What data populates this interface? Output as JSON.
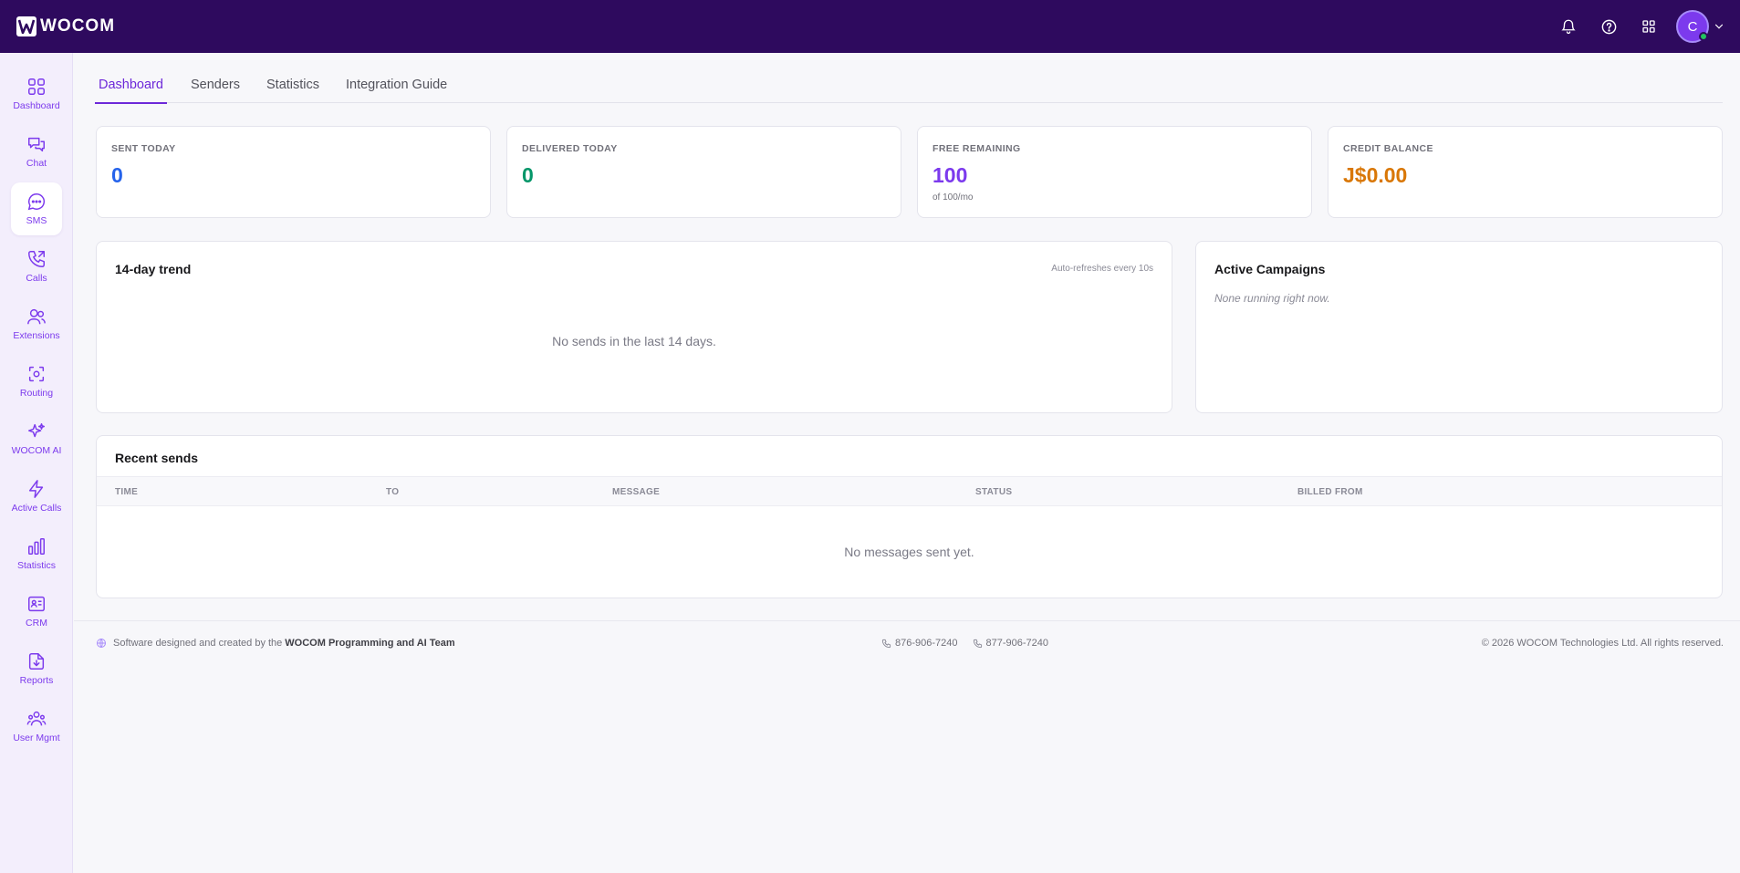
{
  "brand": {
    "name": "WOCOM"
  },
  "topbar": {
    "icons": [
      "bell-icon",
      "help-icon",
      "apps-grid-icon"
    ],
    "avatar_initial": "C"
  },
  "sidebar": {
    "active": "SMS",
    "items": [
      {
        "label": "Dashboard",
        "icon": "grid-icon"
      },
      {
        "label": "Chat",
        "icon": "chat-bubbles-icon"
      },
      {
        "label": "SMS",
        "icon": "message-dots-icon"
      },
      {
        "label": "Calls",
        "icon": "phone-outgoing-icon"
      },
      {
        "label": "Extensions",
        "icon": "users-icon"
      },
      {
        "label": "Routing",
        "icon": "focus-icon"
      },
      {
        "label": "WOCOM AI",
        "icon": "sparkles-icon"
      },
      {
        "label": "Active Calls",
        "icon": "lightning-icon"
      },
      {
        "label": "Statistics",
        "icon": "bar-chart-icon"
      },
      {
        "label": "CRM",
        "icon": "id-card-icon"
      },
      {
        "label": "Reports",
        "icon": "file-download-icon"
      },
      {
        "label": "User Mgmt",
        "icon": "user-group-icon"
      }
    ]
  },
  "tabs": [
    {
      "label": "Dashboard",
      "active": true
    },
    {
      "label": "Senders",
      "active": false
    },
    {
      "label": "Statistics",
      "active": false
    },
    {
      "label": "Integration Guide",
      "active": false
    }
  ],
  "stats": [
    {
      "label": "SENT TODAY",
      "value": "0",
      "color": "#2563eb",
      "sub": ""
    },
    {
      "label": "DELIVERED TODAY",
      "value": "0",
      "color": "#059669",
      "sub": ""
    },
    {
      "label": "FREE REMAINING",
      "value": "100",
      "color": "#7c3aed",
      "sub": "of 100/mo"
    },
    {
      "label": "CREDIT BALANCE",
      "value": "J$0.00",
      "color": "#d97706",
      "sub": ""
    }
  ],
  "trend": {
    "title": "14-day trend",
    "note": "Auto-refreshes every 10s",
    "empty": "No sends in the last 14 days."
  },
  "campaigns": {
    "title": "Active Campaigns",
    "empty": "None running right now."
  },
  "recent": {
    "title": "Recent sends",
    "columns": [
      "TIME",
      "TO",
      "MESSAGE",
      "STATUS",
      "BILLED FROM"
    ],
    "empty": "No messages sent yet."
  },
  "footer": {
    "credit_prefix": "Software designed and created by the",
    "credit_team": "WOCOM Programming and AI Team",
    "phones": [
      "876-906-7240",
      "877-906-7240"
    ],
    "copyright": "© 2026 WOCOM Technologies Ltd. All rights reserved."
  }
}
